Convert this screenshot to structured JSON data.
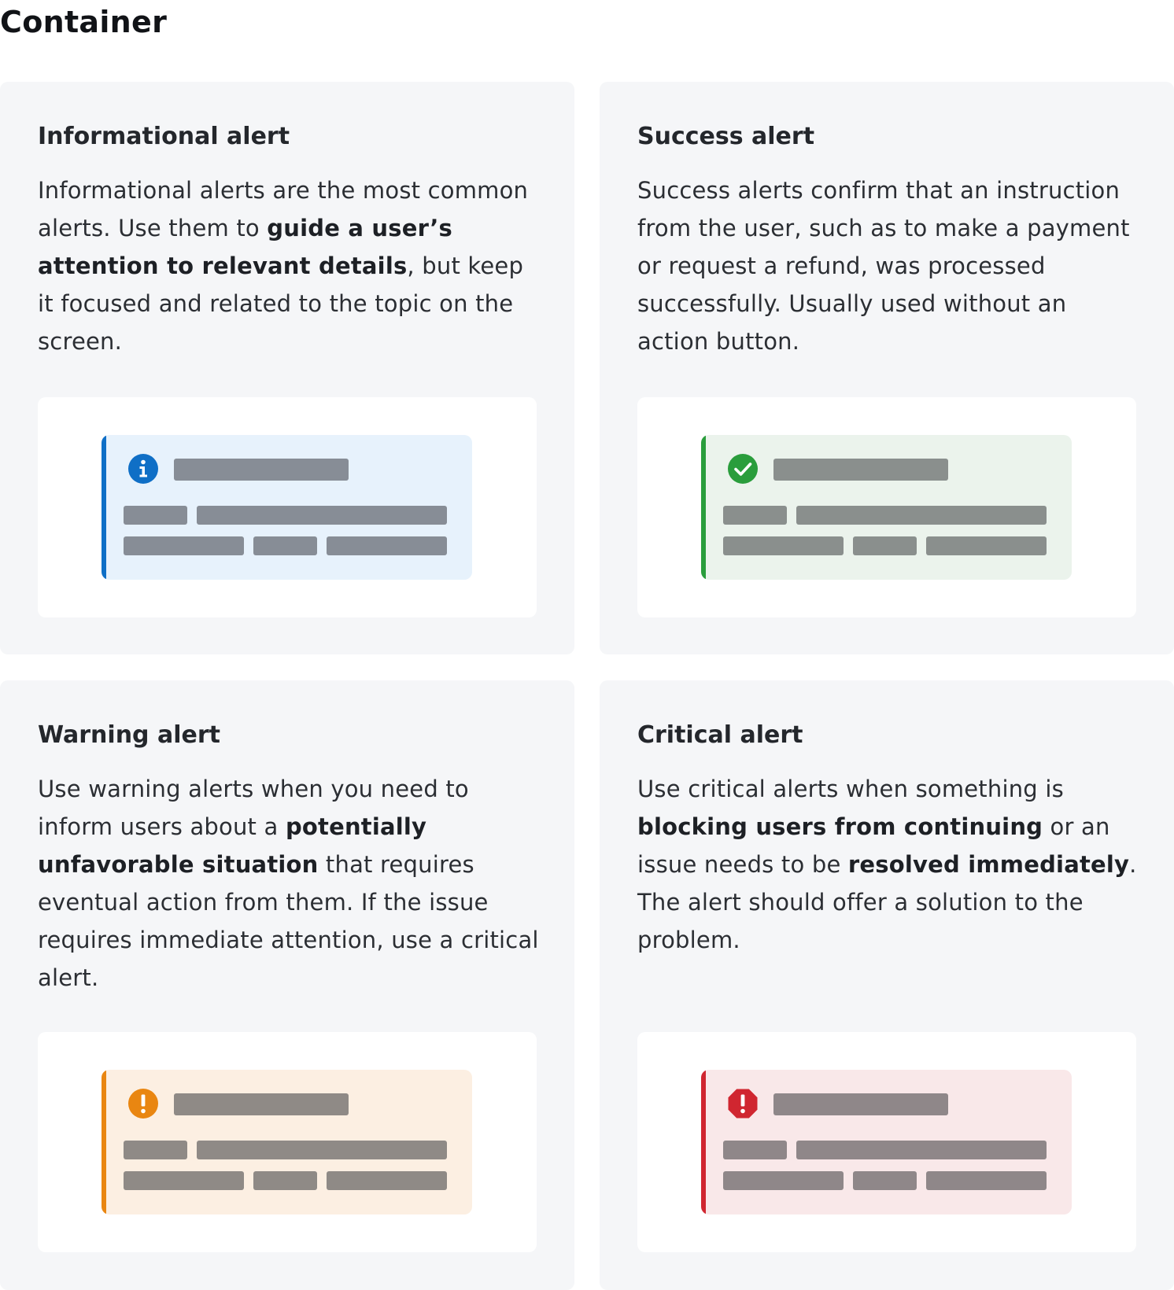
{
  "page": {
    "title": "Container"
  },
  "cards": [
    {
      "title": "Informational alert",
      "description": [
        {
          "text": "Informational alerts are the most common alerts. Use them to ",
          "bold": false
        },
        {
          "text": "guide a user’s attention to relevant details",
          "bold": true
        },
        {
          "text": ", but keep it focused and related to the topic on the screen.",
          "bold": false
        }
      ],
      "preview": {
        "variant": "info",
        "icon": "info-icon",
        "background": "#e7f2fc",
        "accent": "#0f6fc6",
        "line_color": "#878d96"
      }
    },
    {
      "title": "Success alert",
      "description": [
        {
          "text": "Success alerts confirm that an instruction from the user, such as to make a payment or request a refund, was processed successfully. Usually used without an action button.",
          "bold": false
        }
      ],
      "preview": {
        "variant": "success",
        "icon": "checkmark-icon",
        "background": "#ebf3ec",
        "accent": "#2a9d3c",
        "line_color": "#8a8f8d"
      }
    },
    {
      "title": "Warning alert",
      "description": [
        {
          "text": "Use warning alerts when you need to inform users about a ",
          "bold": false
        },
        {
          "text": "potentially unfavorable situation",
          "bold": true
        },
        {
          "text": " that requires eventual action from them. If the issue requires immediate attention, use a critical alert.",
          "bold": false
        }
      ],
      "preview": {
        "variant": "warning",
        "icon": "exclamation-icon",
        "background": "#fcefe2",
        "accent": "#e98611",
        "line_color": "#8f8a86"
      }
    },
    {
      "title": "Critical alert",
      "description": [
        {
          "text": "Use critical alerts when something is ",
          "bold": false
        },
        {
          "text": "blocking users from continuing",
          "bold": true
        },
        {
          "text": " or an issue needs to be ",
          "bold": false
        },
        {
          "text": "resolved immediately",
          "bold": true
        },
        {
          "text": ". The alert should offer a solution to the problem.",
          "bold": false
        }
      ],
      "preview": {
        "variant": "critical",
        "icon": "octagon-exclamation-icon",
        "background": "#f9e8e9",
        "accent": "#d02630",
        "line_color": "#8f8789"
      }
    }
  ]
}
